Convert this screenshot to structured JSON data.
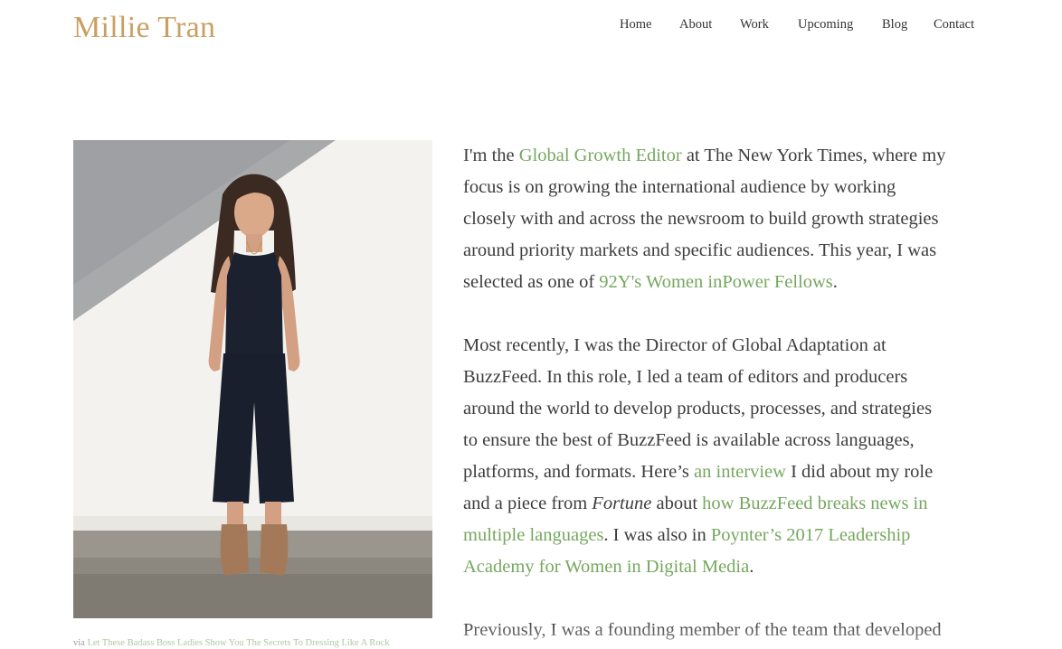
{
  "header": {
    "site_title": "Millie Tran",
    "nav": [
      {
        "label": "Home"
      },
      {
        "label": "About"
      },
      {
        "label": "Work"
      },
      {
        "label": "Upcoming"
      },
      {
        "label": "Blog"
      },
      {
        "label": "Contact"
      }
    ]
  },
  "photo": {
    "caption_prefix": "via",
    "caption_link": "Let These Badass Boss Ladies Show You The Secrets To Dressing Like A Rock"
  },
  "bio": {
    "p1": {
      "l1_a": "I'm the ",
      "l1_link": "Global Growth Editor",
      "l1_b": " at The New York Times, where my",
      "l2": "focus is on growing the international audience by working",
      "l3": "closely with and across the newsroom to build growth strategies",
      "l4": "around priority markets and specific audiences. This year, I was",
      "l5_a": "selected as one of ",
      "l5_link": "92Y's Women inPower Fellows",
      "l5_b": "."
    },
    "p2": {
      "l1": "Most recently, I was the Director of Global Adaptation at",
      "l2": "BuzzFeed. In this role, I led a team of editors and producers",
      "l3": "around the world to develop products, processes, and strategies",
      "l4": "to ensure the best of BuzzFeed is available across languages,",
      "l5_a": "platforms, and formats. Here’s ",
      "l5_link": "an interview",
      "l5_b": " I did about my role",
      "l6_a": "and a piece from ",
      "l6_em": "Fortune",
      "l6_b": " about ",
      "l6_link": "how BuzzFeed breaks news in",
      "l7_link": "multiple languages",
      "l7_a": ". I was also in ",
      "l7_link2": "Poynter’s 2017 Leadership",
      "l8_link": "Academy for Women in Digital Media",
      "l8_b": "."
    },
    "p3": {
      "l1": "Previously, I was a founding member of the team that developed"
    }
  },
  "colors": {
    "title": "#c9a063",
    "link": "#76a75f",
    "body_text": "#3d3d3d",
    "nav_text": "#333333"
  }
}
